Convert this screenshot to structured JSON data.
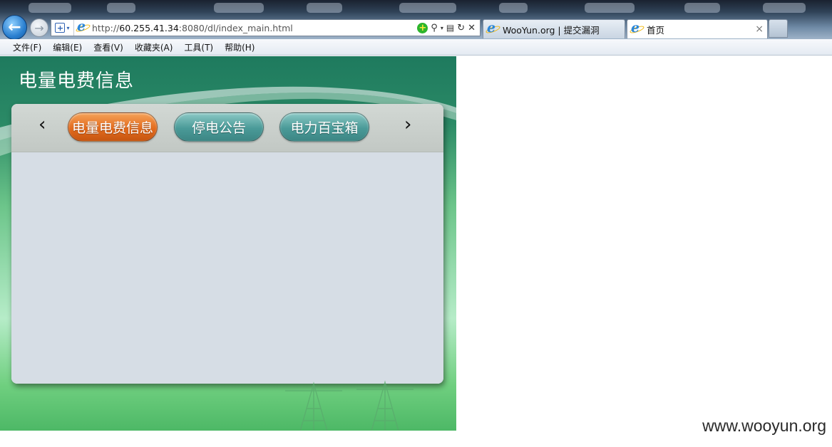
{
  "browser": {
    "url_prefix": "http://",
    "url_host": "60.255.41.34",
    "url_rest": ":8080/dl/index_main.html",
    "tabs": [
      {
        "label": "WooYun.org | 提交漏洞",
        "active": false
      },
      {
        "label": "首页",
        "active": true
      }
    ],
    "close_glyph": "×",
    "icons": [
      "back-arrow",
      "forward-arrow",
      "compat-view",
      "ie-logo",
      "cert",
      "search",
      "refresh",
      "stop"
    ]
  },
  "menubar": {
    "items": [
      "文件(F)",
      "编辑(E)",
      "查看(V)",
      "收藏夹(A)",
      "工具(T)",
      "帮助(H)"
    ]
  },
  "page": {
    "title": "电量电费信息",
    "nav": {
      "prev": "‹",
      "next": "›",
      "tabs": [
        {
          "label": "电量电费信息",
          "active": true
        },
        {
          "label": "停电公告",
          "active": false
        },
        {
          "label": "电力百宝箱",
          "active": false
        }
      ]
    }
  },
  "watermark": "www.wooyun.org",
  "colors": {
    "active_pill": "#e36b1d",
    "inactive_pill": "#4a9a98",
    "header_green": "#1e7a5e"
  }
}
